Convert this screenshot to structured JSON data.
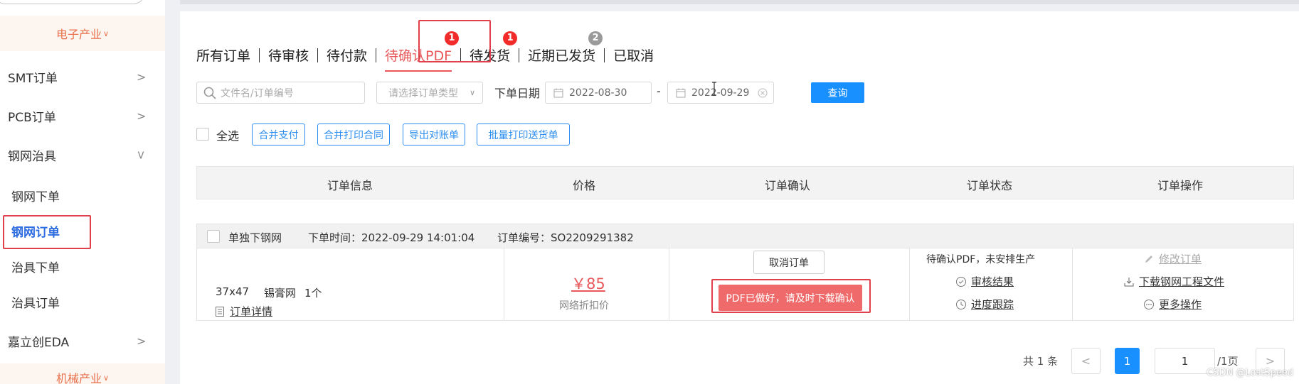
{
  "sidebar": {
    "category_top": "电子产业",
    "category_bottom": "机械产业",
    "items": [
      {
        "label": "SMT订单",
        "has_arrow": true
      },
      {
        "label": "PCB订单",
        "has_arrow": true
      },
      {
        "label": "钢网治具",
        "has_arrow": true,
        "expanded": true
      },
      {
        "label": "钢网下单"
      },
      {
        "label": "钢网订单",
        "active": true
      },
      {
        "label": "治具下单"
      },
      {
        "label": "治具订单"
      },
      {
        "label": "嘉立创EDA",
        "has_arrow": true
      }
    ]
  },
  "tabs": [
    {
      "label": "所有订单"
    },
    {
      "label": "待审核"
    },
    {
      "label": "待付款"
    },
    {
      "label": "待确认PDF",
      "active": true,
      "badge": "1",
      "badge_color": "red"
    },
    {
      "label": "待发货",
      "badge": "1",
      "badge_color": "red"
    },
    {
      "label": "近期已发货",
      "badge": "2",
      "badge_color": "gray"
    },
    {
      "label": "已取消"
    }
  ],
  "filters": {
    "search_placeholder": "文件名/订单编号",
    "type_placeholder": "请选择订单类型",
    "date_label": "下单日期",
    "date_from": "2022-08-30",
    "date_sep": "-",
    "date_to": "2022-09-29",
    "query_label": "查询"
  },
  "actions": {
    "select_all": "全选",
    "buttons": [
      "合并支付",
      "合并打印合同",
      "导出对账单",
      "批量打印送货单"
    ]
  },
  "table_headers": [
    "订单信息",
    "价格",
    "订单确认",
    "订单状态",
    "订单操作"
  ],
  "order": {
    "type": "单独下钢网",
    "time_label": "下单时间：2022-09-29 14:01:04",
    "id_label": "订单编号：SO2209291382",
    "size": "37x47",
    "material": "锡膏网",
    "quantity": "1个",
    "detail_link": "订单详情",
    "price": "￥85",
    "price_note": "网络折扣价",
    "cancel_label": "取消订单",
    "pdf_confirm_label": "PDF已做好，请及时下载确认",
    "status": "待确认PDF，未安排生产",
    "audit_result": "审核结果",
    "progress": "进度跟踪",
    "modify": "修改订单",
    "download": "下载钢网工程文件",
    "more": "更多操作"
  },
  "pagination": {
    "total": "共 1 条",
    "prev": "<",
    "current": "1",
    "page_input": "1",
    "page_total": "/1页",
    "next": ">"
  },
  "watermark": "CSDN @LostSpeed",
  "colors": {
    "accent_red": "#e8585a",
    "primary_blue": "#1890ff",
    "highlight_box": "#e0404a"
  }
}
